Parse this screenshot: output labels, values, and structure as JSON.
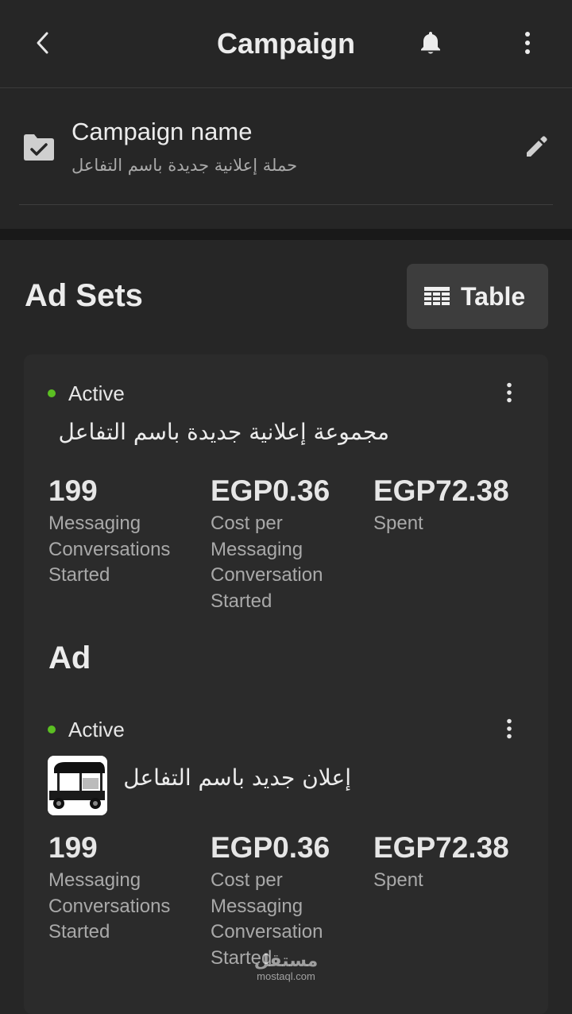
{
  "header": {
    "title": "Campaign",
    "back_icon": "chevron-left-icon",
    "bell_icon": "bell-icon",
    "more_icon": "more-vertical-icon"
  },
  "campaign": {
    "label": "Campaign name",
    "value": "حملة إعلانية جديدة باسم التفاعل",
    "icon": "folder-check-icon",
    "edit_icon": "pencil-icon"
  },
  "ad_sets": {
    "heading": "Ad Sets",
    "view_button": {
      "label": "Table",
      "icon": "table-icon"
    },
    "item": {
      "status": "Active",
      "status_color": "#5bbf22",
      "name": "مجموعة إعلانية جديدة باسم التفاعل",
      "metrics": [
        {
          "value": "199",
          "label": "Messaging Conversations Started"
        },
        {
          "value": "EGP0.36",
          "label": "Cost per Messaging Conversation Started"
        },
        {
          "value": "EGP72.38",
          "label": "Spent"
        }
      ]
    }
  },
  "ads": {
    "heading": "Ad",
    "item": {
      "status": "Active",
      "name": "إعلان جديد باسم التفاعل",
      "thumbnail": "tuk-tuk-image",
      "metrics": [
        {
          "value": "199",
          "label": "Messaging Conversations Started"
        },
        {
          "value": "EGP0.36",
          "label": "Cost per Messaging Conversation Started"
        },
        {
          "value": "EGP72.38",
          "label": "Spent"
        }
      ]
    }
  },
  "watermark": {
    "arabic": "مستقل",
    "latin": "mostaql.com"
  }
}
